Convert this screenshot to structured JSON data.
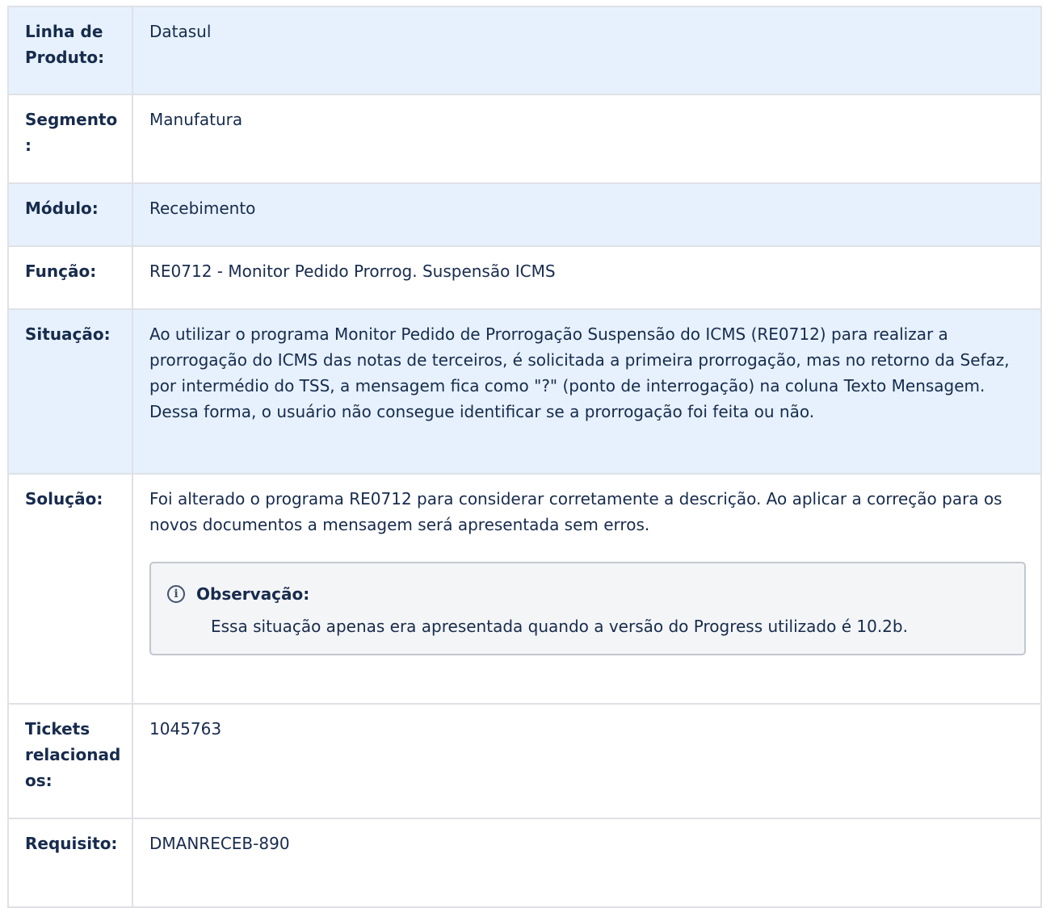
{
  "rows": [
    {
      "label": "Linha de Produto:",
      "value": "Datasul"
    },
    {
      "label": "Segmento:",
      "value": "Manufatura"
    },
    {
      "label": "Módulo:",
      "value": "Recebimento"
    },
    {
      "label": "Função:",
      "value": "RE0712 - Monitor Pedido Prorrog. Suspensão ICMS"
    },
    {
      "label": "Situação:",
      "value": "Ao utilizar o programa Monitor Pedido de Prorrogação Suspensão do ICMS (RE0712) para realizar a prorrogação do ICMS das notas de terceiros, é solicitada a primeira prorrogação, mas no retorno da Sefaz, por intermédio do TSS, a mensagem fica como \"?\" (ponto de interrogação) na coluna Texto Mensagem. Dessa forma, o usuário não consegue identificar se a prorrogação foi feita ou não."
    },
    {
      "label": "Solução:",
      "value": "Foi alterado o programa RE0712 para considerar corretamente a descrição. Ao aplicar a correção para os novos documentos a mensagem será apresentada sem erros."
    },
    {
      "label": "Tickets relacionados:",
      "value": "1045763"
    },
    {
      "label": "Requisito:",
      "value": "DMANRECEB-890"
    }
  ],
  "note": {
    "icon": "info-icon",
    "title": "Observação:",
    "text": "Essa situação apenas era apresentada quando a versão do Progress utilizado é 10.2b."
  }
}
